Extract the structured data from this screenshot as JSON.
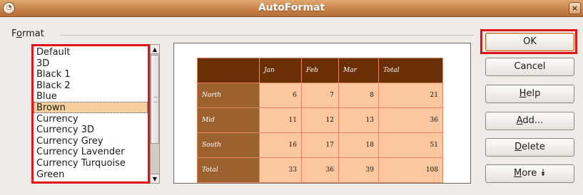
{
  "window": {
    "title": "AutoFormat",
    "close_glyph": "×",
    "app_icon_glyph": "◔"
  },
  "format": {
    "group_label": "Format",
    "items": [
      "Default",
      "3D",
      "Black 1",
      "Black 2",
      "Blue",
      "Brown",
      "Currency",
      "Currency 3D",
      "Currency Grey",
      "Currency Lavender",
      "Currency Turquoise",
      "Green"
    ],
    "selected": "Brown"
  },
  "preview": {
    "headers": [
      "",
      "Jan",
      "Feb",
      "Mar",
      "Total"
    ],
    "rows": [
      {
        "label": "North",
        "values": [
          "6",
          "7",
          "8",
          "21"
        ]
      },
      {
        "label": "Mid",
        "values": [
          "11",
          "12",
          "13",
          "36"
        ]
      },
      {
        "label": "South",
        "values": [
          "16",
          "17",
          "18",
          "51"
        ]
      },
      {
        "label": "Total",
        "values": [
          "33",
          "36",
          "39",
          "108"
        ]
      }
    ],
    "colors": {
      "header_bg": "#6a2f04",
      "row_header_bg": "#9b6230",
      "cell_bg": "#fdc79f",
      "grid_line": "#e6855f"
    }
  },
  "buttons": {
    "ok": "OK",
    "cancel": "Cancel",
    "help": "Help",
    "add": "Add...",
    "delete": "Delete",
    "more": "More",
    "more_glyph": "⯯"
  },
  "scrollbar": {
    "up_glyph": "▲",
    "down_glyph": "▼"
  },
  "highlight_color": "#e0121a"
}
